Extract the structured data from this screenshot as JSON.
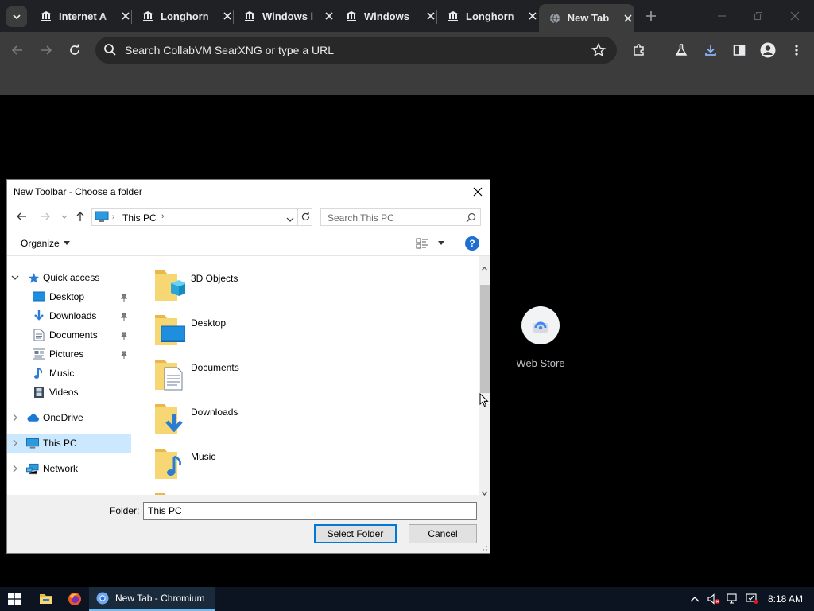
{
  "browser": {
    "tabs": [
      {
        "title": "Internet A",
        "icon": "bank-icon"
      },
      {
        "title": "Longhorn",
        "icon": "bank-icon"
      },
      {
        "title": "Windows l",
        "icon": "bank-icon"
      },
      {
        "title": "Windows",
        "icon": "bank-icon"
      },
      {
        "title": "Longhorn",
        "icon": "bank-icon"
      },
      {
        "title": "New Tab",
        "icon": "globe-icon",
        "active": true
      }
    ],
    "omnibox_placeholder": "Search CollabVM SearXNG or type a URL"
  },
  "newtab": {
    "shortcut_label": "Web Store"
  },
  "dialog": {
    "title": "New Toolbar - Choose a folder",
    "address": "This PC",
    "search_placeholder": "Search This PC",
    "organize_label": "Organize",
    "help_label": "?",
    "nav_items": [
      {
        "label": "Quick access",
        "icon": "star-icon"
      },
      {
        "label": "Desktop",
        "icon": "desktop-icon"
      },
      {
        "label": "Downloads",
        "icon": "download-arrow-icon"
      },
      {
        "label": "Documents",
        "icon": "document-icon"
      },
      {
        "label": "Pictures",
        "icon": "picture-icon"
      },
      {
        "label": "Music",
        "icon": "music-note-icon"
      },
      {
        "label": "Videos",
        "icon": "film-icon"
      },
      {
        "label": "OneDrive",
        "icon": "cloud-icon"
      },
      {
        "label": "This PC",
        "icon": "computer-icon"
      },
      {
        "label": "Network",
        "icon": "network-icon"
      }
    ],
    "folders": [
      {
        "name": "3D Objects"
      },
      {
        "name": "Desktop"
      },
      {
        "name": "Documents"
      },
      {
        "name": "Downloads"
      },
      {
        "name": "Music"
      }
    ],
    "folder_label": "Folder:",
    "folder_value": "This PC",
    "select_button": "Select Folder",
    "cancel_button": "Cancel"
  },
  "taskbar": {
    "active_window": "New Tab - Chromium",
    "clock": "8:18 AM"
  },
  "colors": {
    "accent": "#0078d7",
    "selection": "#cce8ff",
    "chrome_dark": "#202124",
    "taskbar": "#0b1420"
  }
}
